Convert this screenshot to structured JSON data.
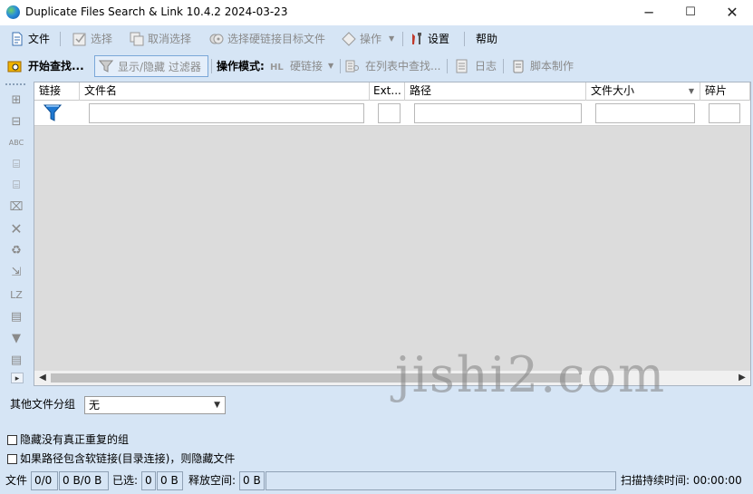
{
  "window": {
    "title": "Duplicate Files Search & Link 10.4.2 2024-03-23",
    "min_symbol": "─",
    "max_symbol": "☐",
    "close_symbol": "✕"
  },
  "menu": {
    "file": "文件",
    "select": "选择",
    "deselect": "取消选择",
    "select_hardlink_targets": "选择硬链接目标文件",
    "actions": "操作",
    "settings": "设置",
    "help": "帮助"
  },
  "toolbar": {
    "start_search": "开始查找...",
    "show_hide_filter": "显示/隐藏 过滤器",
    "operation_mode": "操作模式:",
    "hardlink": "硬链接",
    "find_in_list": "在列表中查找...",
    "log": "日志",
    "script": "脚本制作"
  },
  "vertical_tools": {
    "lz_label": "LZ",
    "abc_label": "ABC"
  },
  "grid": {
    "columns": [
      "链接",
      "文件名",
      "Ext...",
      "路径",
      "文件大小",
      "碎片"
    ],
    "filters": {
      "filename": "",
      "ext": "",
      "path": "",
      "size": "",
      "fragments": ""
    }
  },
  "other_groups": {
    "label": "其他文件分组",
    "selected": "无"
  },
  "checkboxes": {
    "hide_no_real_dup": "隐藏没有真正重复的组",
    "hide_symlink_paths": "如果路径包含软链接(目录连接)，则隐藏文件"
  },
  "status": {
    "files_label": "文件",
    "files_count": "0/0",
    "files_size": "0 B/0 B",
    "selected_label": "已选:",
    "selected_count": "0",
    "selected_size": "0 B",
    "free_label": "释放空间:",
    "free_value": "0 B",
    "scan_duration": "扫描持续时间: 00:00:00"
  },
  "watermark": "jishi2.com",
  "colors": {
    "chrome_bg": "#d6e5f5",
    "grid_bg": "#dcdcdc",
    "funnel": "#1f78d1"
  }
}
